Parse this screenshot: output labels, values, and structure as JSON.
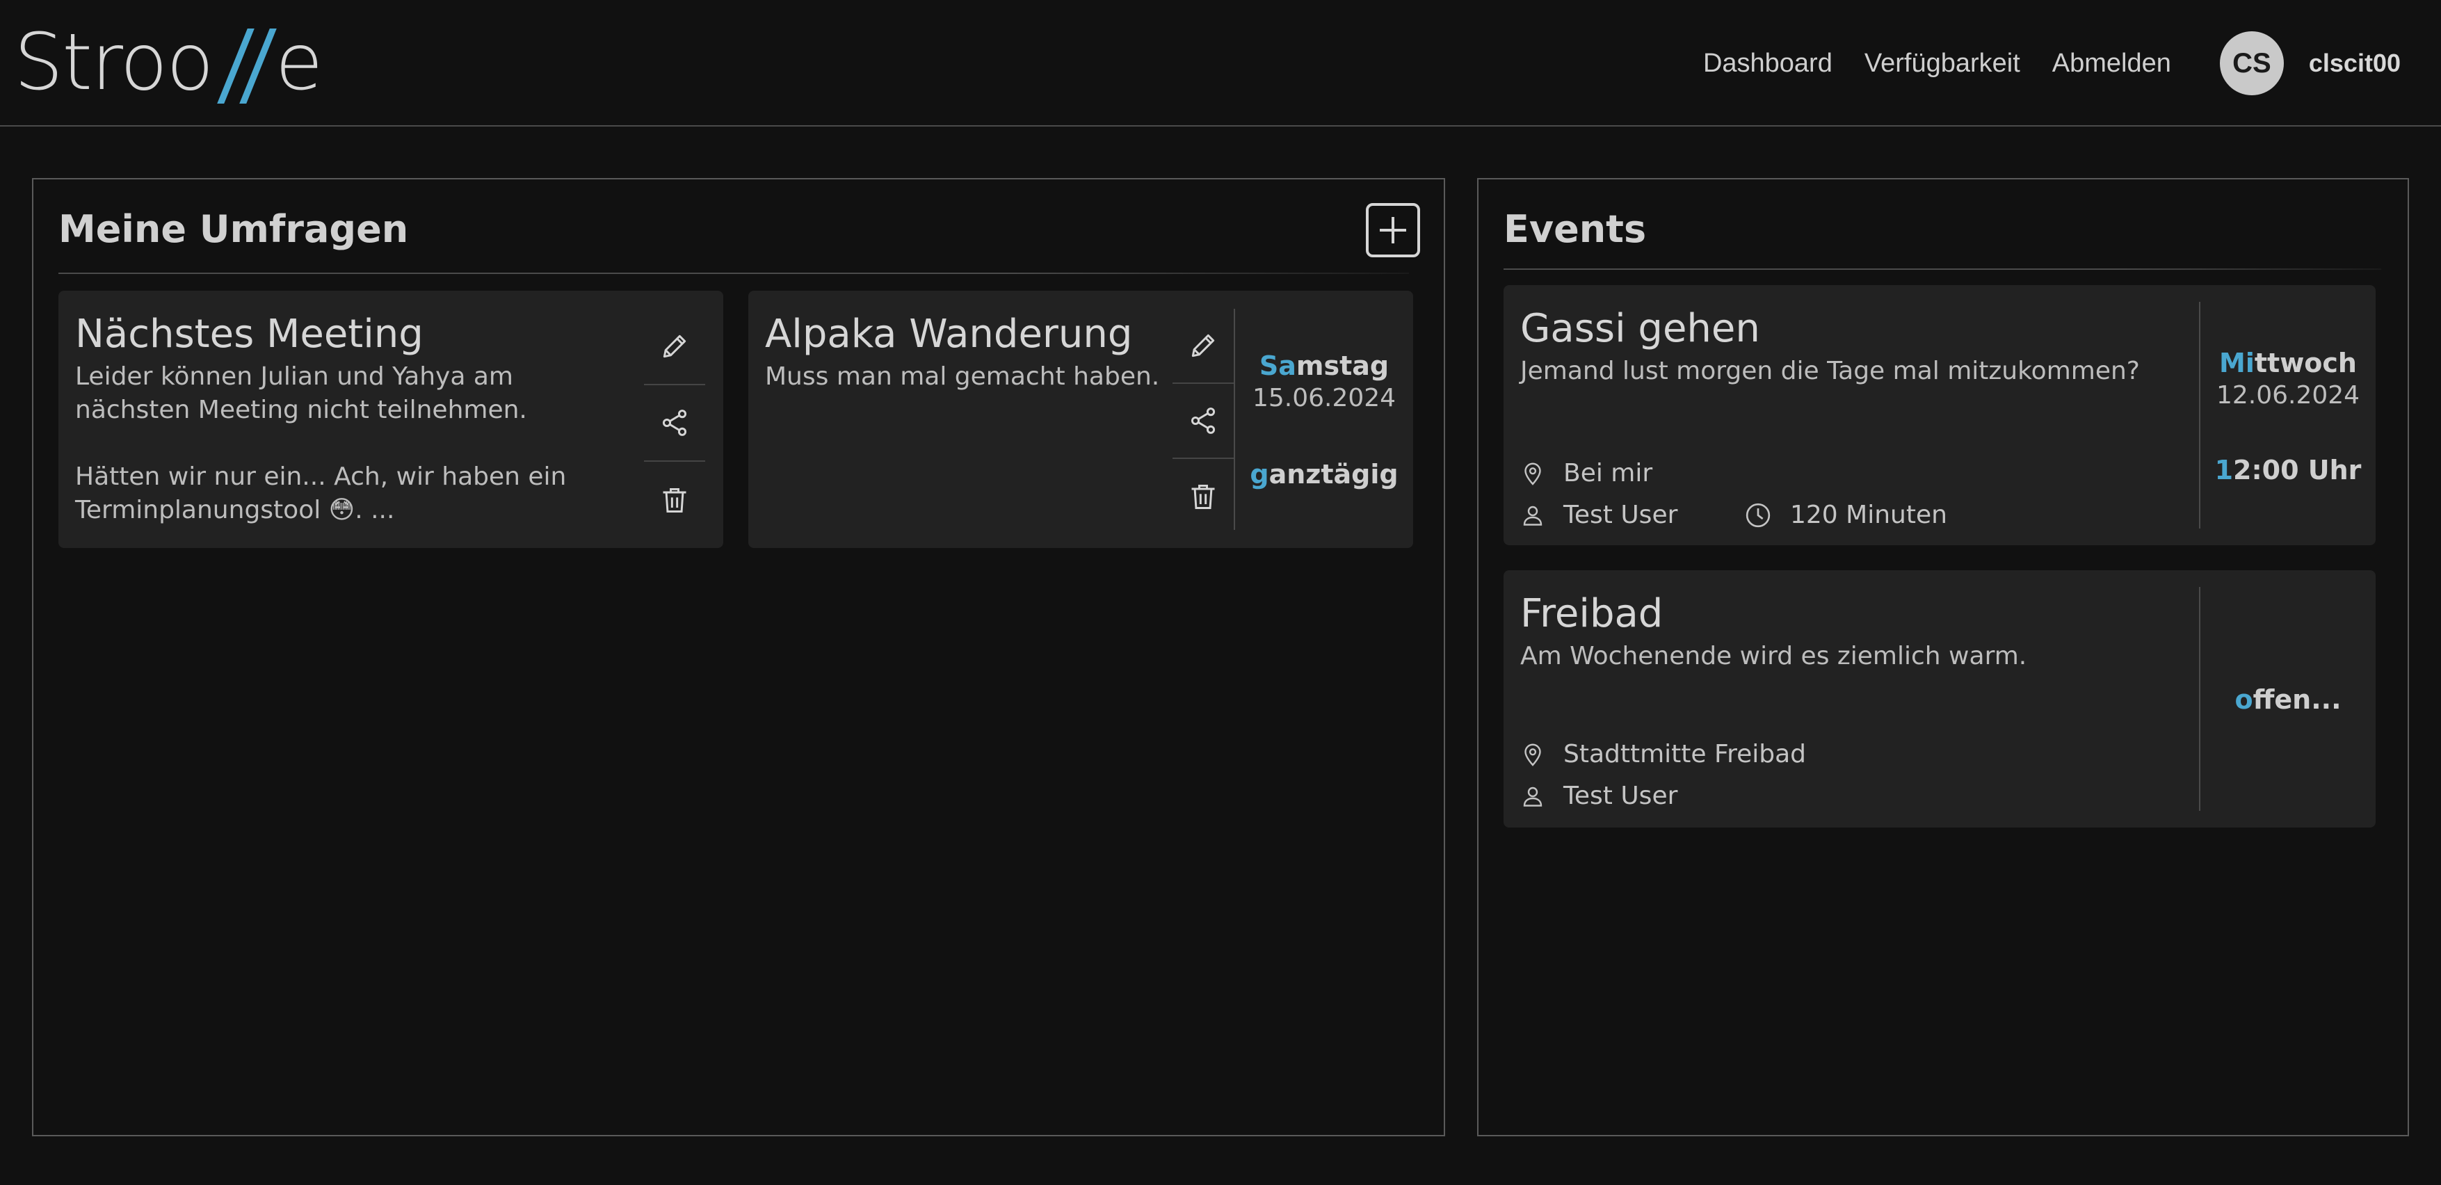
{
  "header": {
    "logo_text_left": "Stroo",
    "logo_text_right": "e",
    "nav": [
      "Dashboard",
      "Verfügbarkeit",
      "Abmelden"
    ],
    "avatar_initials": "CS",
    "username": "clscit00"
  },
  "polls": {
    "title": "Meine Umfragen",
    "items": [
      {
        "title": "Nächstes Meeting",
        "description": "Leider können Julian und Yahya am nächsten Meeting nicht teilnehmen.\n\nHätten wir nur ein...  Ach, wir haben ein Terminplanungstool 😳. ...",
        "actions": [
          "edit-icon",
          "share-icon",
          "delete-icon"
        ]
      },
      {
        "title": "Alpaka Wanderung",
        "description": "Muss man mal gemacht haben.",
        "actions": [
          "edit-icon",
          "share-icon",
          "delete-icon"
        ],
        "day_accent": "Sa",
        "day_rest": "mstag",
        "date": "15.06.2024",
        "time_accent": "g",
        "time_rest": "anztägig"
      }
    ]
  },
  "events": {
    "title": "Events",
    "items": [
      {
        "title": "Gassi gehen",
        "description": "Jemand lust morgen die Tage mal mitzukommen?",
        "location": "Bei mir",
        "user": "Test User",
        "duration": "120 Minuten",
        "day_accent": "Mi",
        "day_rest": "ttwoch",
        "date": "12.06.2024",
        "time_accent": "1",
        "time_rest": "2:00 Uhr"
      },
      {
        "title": "Freibad",
        "description": "Am Wochenende wird es ziemlich warm.",
        "location": "Stadttmitte Freibad",
        "user": "Test User",
        "time_accent": "o",
        "time_rest": "ffen..."
      }
    ]
  },
  "colors": {
    "accent": "#4aa7d0",
    "background": "#111111",
    "card": "#222222"
  }
}
